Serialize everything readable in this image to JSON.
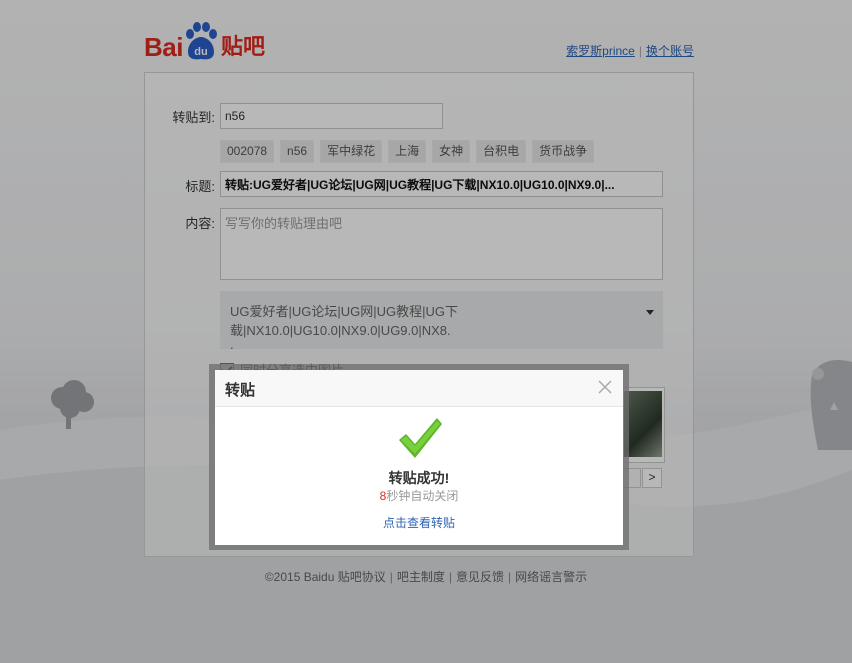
{
  "header": {
    "logo_text": "Bai",
    "logo_du": "du",
    "logo_tieba": "贴吧",
    "username": "索罗斯prince",
    "switch_account": "换个账号"
  },
  "form": {
    "target_label": "转贴到:",
    "target_value": "n56",
    "tags": [
      "002078",
      "n56",
      "军中绿花",
      "上海",
      "女神",
      "台积电",
      "货币战争"
    ],
    "title_label": "标题:",
    "title_value": "转贴:UG爱好者|UG论坛|UG网|UG教程|UG下载|NX10.0|UG10.0|NX9.0|...",
    "content_label": "内容:",
    "content_placeholder": "写写你的转贴理由吧",
    "quote_text": "UG爱好者|UG论坛|UG网|UG教程|UG下载|NX10.0|UG10.0|NX9.0|UG9.0|NX8.",
    "quote_more": ".",
    "share_image_label": "同时分享选中图片",
    "pager_next": ">"
  },
  "footer": {
    "copyright": "©2015 Baidu",
    "links": [
      "贴吧协议",
      "吧主制度",
      "意见反馈",
      "网络谣言警示"
    ]
  },
  "dialog": {
    "title": "转贴",
    "success": "转贴成功!",
    "countdown_num": "8",
    "countdown_text": "秒钟自动关闭",
    "view_link": "点击查看转贴"
  },
  "colors": {
    "brand_red": "#e02a20",
    "link_blue": "#2d64b3",
    "check_green": "#5cb52a"
  }
}
